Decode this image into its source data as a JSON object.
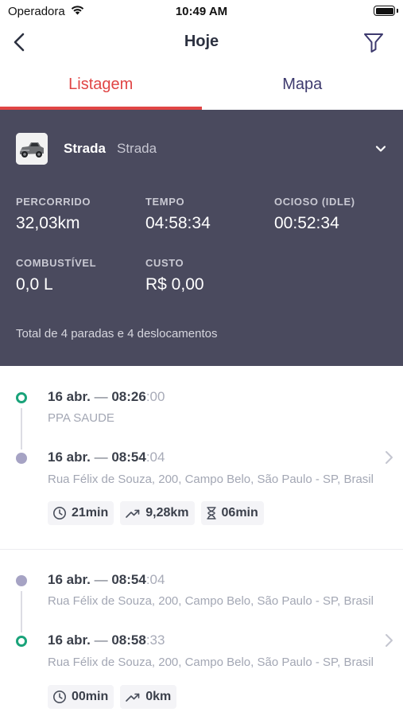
{
  "status_bar": {
    "carrier": "Operadora",
    "time": "10:49 AM"
  },
  "nav": {
    "title": "Hoje"
  },
  "tabs": [
    {
      "label": "Listagem",
      "active": true
    },
    {
      "label": "Mapa",
      "active": false
    }
  ],
  "vehicle": {
    "name": "Strada",
    "model": "Strada"
  },
  "metrics": {
    "distance": {
      "label": "PERCORRIDO",
      "value": "32,03km"
    },
    "time": {
      "label": "TEMPO",
      "value": "04:58:34"
    },
    "idle": {
      "label": "OCIOSO (IDLE)",
      "value": "00:52:34"
    },
    "fuel": {
      "label": "COMBUSTÍVEL",
      "value": "0,0 L"
    },
    "cost": {
      "label": "CUSTO",
      "value": "R$ 0,00"
    }
  },
  "summary_total": "Total de 4 paradas e 4 deslocamentos",
  "trips": [
    {
      "start": {
        "date": "16 abr.",
        "separator": "—",
        "hm": "08:26",
        "ss": ":00",
        "address": "PPA SAUDE"
      },
      "end": {
        "date": "16 abr.",
        "separator": "—",
        "hm": "08:54",
        "ss": ":04",
        "address": "Rua Félix de Souza, 200, Campo Belo, São Paulo - SP, Brasil"
      },
      "duration": "21min",
      "distance": "9,28km",
      "idle": "06min"
    },
    {
      "start": {
        "date": "16 abr.",
        "separator": "—",
        "hm": "08:54",
        "ss": ":04",
        "address": "Rua Félix de Souza, 200, Campo Belo, São Paulo - SP, Brasil"
      },
      "end": {
        "date": "16 abr.",
        "separator": "—",
        "hm": "08:58",
        "ss": ":33",
        "address": "Rua Félix de Souza, 200, Campo Belo, São Paulo - SP, Brasil"
      },
      "duration": "00min",
      "distance": "0km"
    }
  ],
  "colors": {
    "accent": "#e04545",
    "panel": "#4a4a5e",
    "start_dot": "#1aa37a",
    "end_dot": "#a6a3c4",
    "tab_inactive": "#3d3a6e"
  },
  "icons": {
    "back": "chevron-left-icon",
    "filter": "filter-icon",
    "expand": "chevron-down-icon",
    "duration": "clock-icon",
    "distance": "trending-up-icon",
    "idle": "hourglass-icon",
    "open": "chevron-right-icon"
  }
}
